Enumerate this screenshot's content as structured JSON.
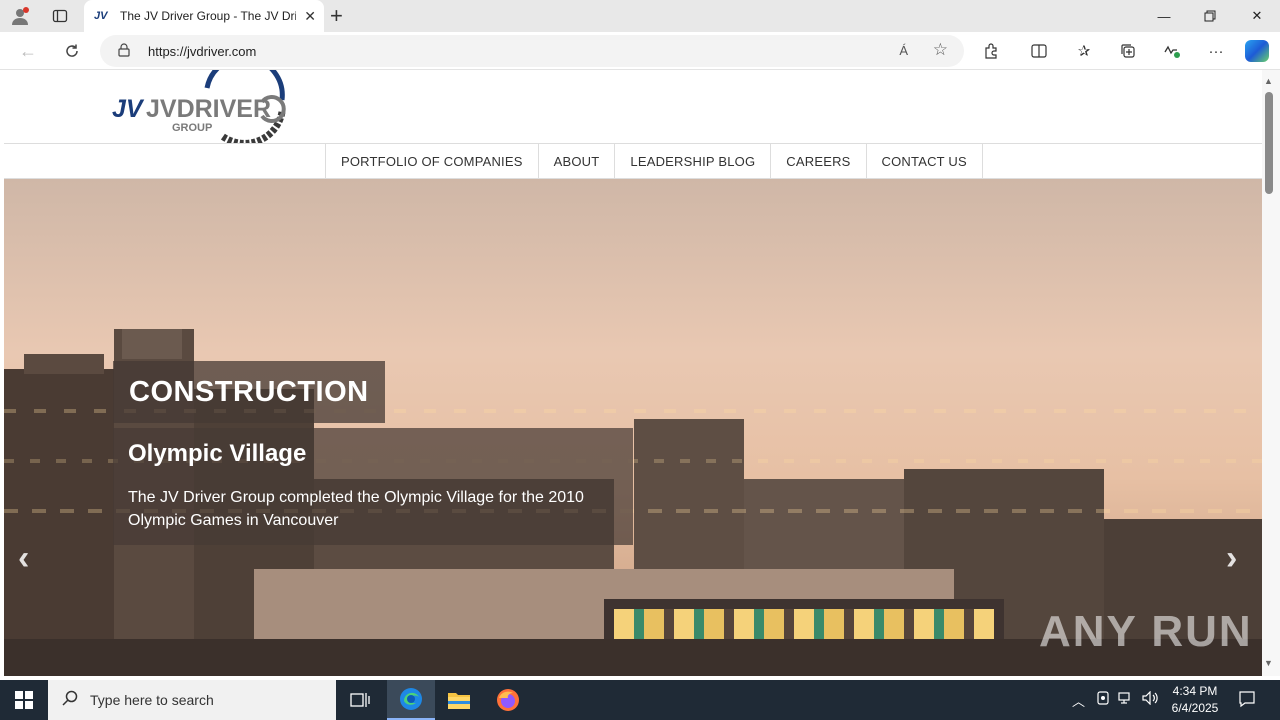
{
  "browser": {
    "tab_title": "The JV Driver Group - The JV Drive",
    "tab_favicon_text": "JV",
    "url": "https://jvdriver.com",
    "read_aloud_label": "Á"
  },
  "site": {
    "logo_text": "JVDRIVER",
    "logo_sub": "GROUP",
    "nav": [
      {
        "label": "PORTFOLIO OF COMPANIES"
      },
      {
        "label": "ABOUT"
      },
      {
        "label": "LEADERSHIP BLOG"
      },
      {
        "label": "CAREERS"
      },
      {
        "label": "CONTACT US"
      }
    ],
    "slide": {
      "category": "CONSTRUCTION",
      "title": "Olympic Village",
      "description": "The JV Driver Group completed the Olympic Village for the 2010 Olympic Games in Vancouver"
    },
    "prev_arrow": "‹",
    "next_arrow": "›",
    "watermark": "ANY RUN"
  },
  "taskbar": {
    "search_placeholder": "Type here to search",
    "time": "4:34 PM",
    "date": "6/4/2025"
  },
  "icons": [
    "profile-icon",
    "tab-actions-icon",
    "close-tab-icon",
    "new-tab-icon",
    "minimize-icon",
    "restore-icon",
    "close-window-icon",
    "back-icon",
    "refresh-icon",
    "lock-icon",
    "read-aloud-icon",
    "favorite-star-icon",
    "extensions-icon",
    "split-screen-icon",
    "favorites-icon",
    "collections-icon",
    "performance-icon",
    "more-icon",
    "copilot-icon",
    "windows-start-icon",
    "search-icon",
    "task-view-icon",
    "edge-icon",
    "file-explorer-icon",
    "firefox-icon",
    "chevron-up-icon",
    "network-icon",
    "volume-icon",
    "notification-icon"
  ],
  "colors": {
    "brand_navy": "#1b3d7a",
    "brand_gray": "#7a7a7a",
    "caption_bg": "#463a34",
    "taskbar_bg": "#1f2a36"
  }
}
